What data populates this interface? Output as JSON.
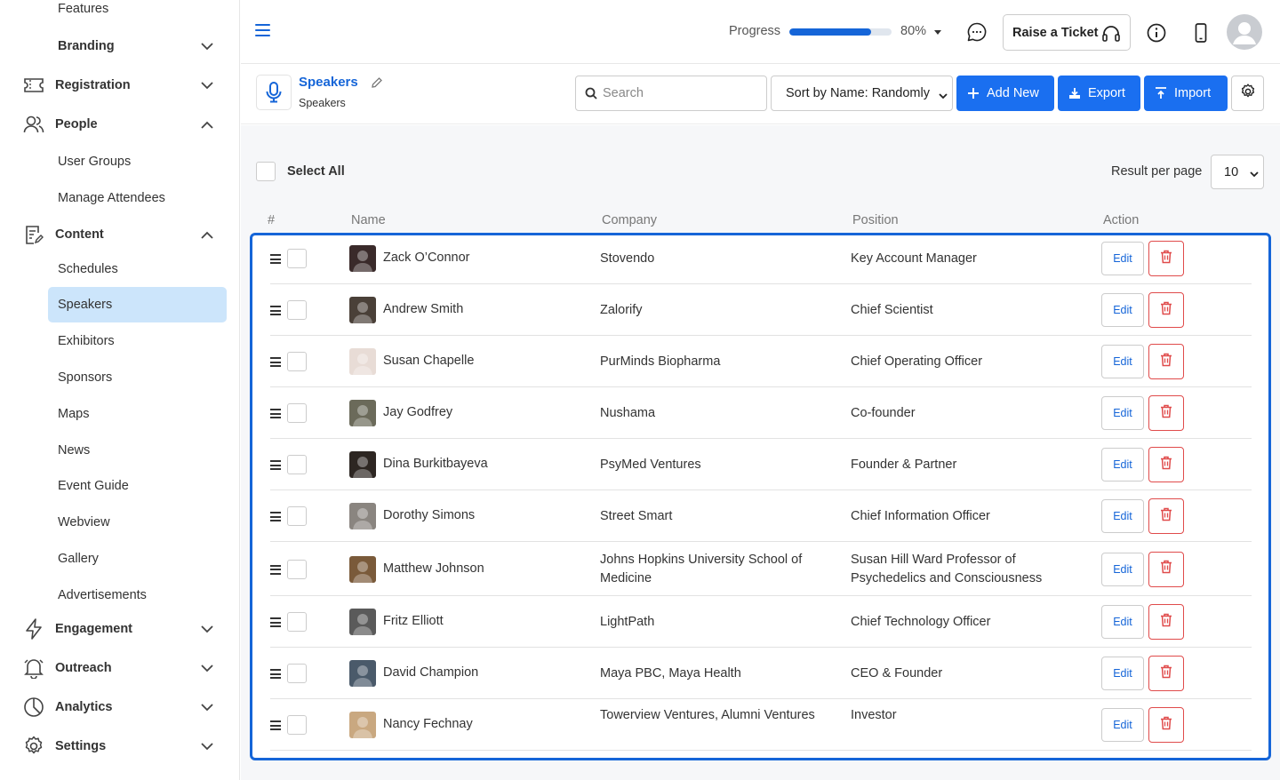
{
  "sidebar": {
    "top_items": [
      {
        "label": "Features"
      },
      {
        "label": "Branding"
      }
    ],
    "groups": {
      "registration": {
        "label": "Registration"
      },
      "people": {
        "label": "People",
        "items": [
          {
            "label": "User Groups"
          },
          {
            "label": "Manage Attendees"
          }
        ]
      },
      "content": {
        "label": "Content",
        "items": [
          {
            "label": "Schedules"
          },
          {
            "label": "Speakers"
          },
          {
            "label": "Exhibitors"
          },
          {
            "label": "Sponsors"
          },
          {
            "label": "Maps"
          },
          {
            "label": "News"
          },
          {
            "label": "Event Guide"
          },
          {
            "label": "Webview"
          },
          {
            "label": "Gallery"
          },
          {
            "label": "Advertisements"
          }
        ]
      },
      "engagement": {
        "label": "Engagement"
      },
      "outreach": {
        "label": "Outreach"
      },
      "analytics": {
        "label": "Analytics"
      },
      "settings": {
        "label": "Settings"
      }
    },
    "active_item": "Speakers"
  },
  "header": {
    "progress_label": "Progress",
    "progress_value": 0.8,
    "progress_text": "80%",
    "ticket_label": "Raise a Ticket"
  },
  "page": {
    "title": "Speakers",
    "subtitle": "Speakers",
    "search_placeholder": "Search",
    "sort_value": "Sort by Name: Randomly",
    "add_label": "Add New",
    "export_label": "Export",
    "import_label": "Import",
    "accent_color": "#1a6ff0"
  },
  "list": {
    "select_all_label": "Select All",
    "rpp_label": "Result per page",
    "rpp_value": "10",
    "columns": {
      "num": "#",
      "name": "Name",
      "company": "Company",
      "position": "Position",
      "action": "Action"
    },
    "edit_label": "Edit",
    "rows": [
      {
        "name": "Zack O’Connor",
        "company": "Stovendo",
        "position": "Key Account Manager",
        "avatar_bg": "#3a2a2a"
      },
      {
        "name": "Andrew Smith",
        "company": "Zalorify",
        "position": "Chief Scientist",
        "avatar_bg": "#4a4038"
      },
      {
        "name": "Susan Chapelle",
        "company": "PurMinds Biopharma",
        "position": "Chief Operating Officer",
        "avatar_bg": "#e8dcd6"
      },
      {
        "name": "Jay Godfrey",
        "company": "Nushama",
        "position": "Co-founder",
        "avatar_bg": "#6b6a5a"
      },
      {
        "name": "Dina Burkitbayeva",
        "company": "PsyMed Ventures",
        "position": "Founder & Partner",
        "avatar_bg": "#2d2622"
      },
      {
        "name": "Dorothy Simons",
        "company": "Street Smart",
        "position": "Chief Information Officer",
        "avatar_bg": "#8a8580"
      },
      {
        "name": "Matthew Johnson",
        "company": "Johns Hopkins University School of Medicine",
        "position": "Susan Hill Ward Professor of Psychedelics and Consciousness",
        "avatar_bg": "#7a5a3a"
      },
      {
        "name": "Fritz Elliott",
        "company": "LightPath",
        "position": "Chief Technology Officer",
        "avatar_bg": "#5a5a5a"
      },
      {
        "name": "David Champion",
        "company": "Maya PBC, Maya Health",
        "position": "CEO & Founder",
        "avatar_bg": "#4a5a6a"
      },
      {
        "name": "Nancy Fechnay",
        "company": "Towerview Ventures, Alumni Ventures",
        "position": "Investor",
        "avatar_bg": "#c9a880"
      }
    ]
  }
}
